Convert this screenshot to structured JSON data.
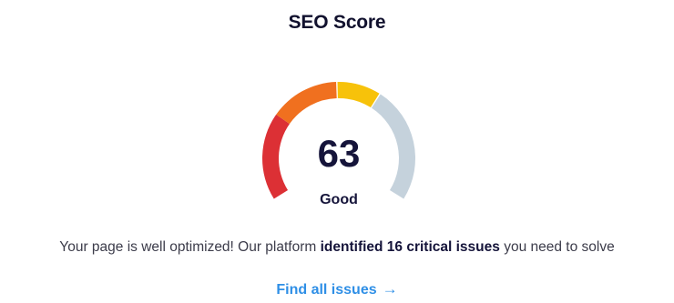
{
  "widget": {
    "title": "SEO Score",
    "score": "63",
    "score_value": 63,
    "score_max": 100,
    "rating": "Good",
    "message_prefix": "Your page is well optimized! Our platform ",
    "message_bold": "identified 16 critical issues",
    "message_suffix": " you need to solve",
    "cta_label": "Find all issues",
    "cta_icon": "arrow-right-icon"
  },
  "gauge": {
    "segments": [
      {
        "name": "poor",
        "color": "#dc3035"
      },
      {
        "name": "fair",
        "color": "#f0701f"
      },
      {
        "name": "good",
        "color": "#f7c20a"
      },
      {
        "name": "remaining",
        "color": "#c5d2dc"
      }
    ]
  },
  "colors": {
    "title": "#11112e",
    "text": "#3c3c4a",
    "accent": "#2f8fe6"
  }
}
